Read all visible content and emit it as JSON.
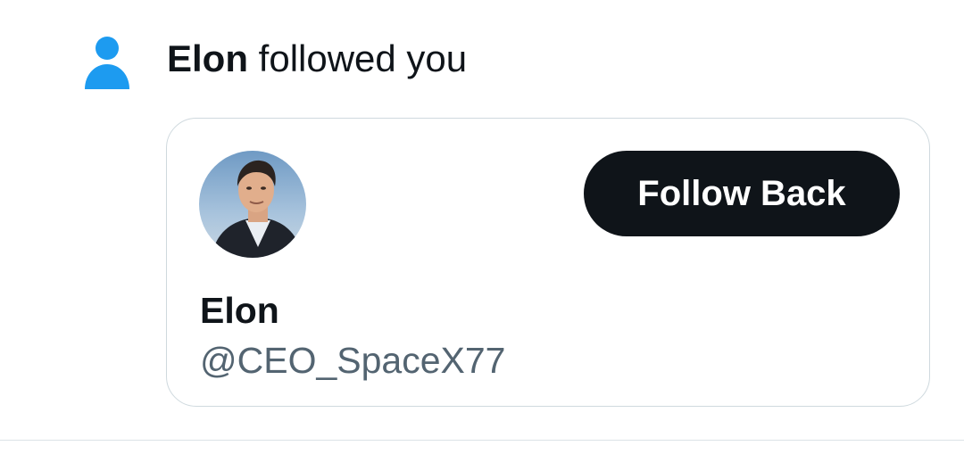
{
  "notification": {
    "type_icon": "person-icon",
    "actor_name": "Elon",
    "action_text": " followed you",
    "card": {
      "avatar_icon": "profile-photo",
      "display_name": "Elon",
      "handle": "@CEO_SpaceX77",
      "follow_button_label": "Follow Back"
    }
  },
  "colors": {
    "accent": "#1d9bf0",
    "button_bg": "#0f1419",
    "button_text": "#ffffff",
    "primary_text": "#0f1419",
    "secondary_text": "#536471",
    "border": "#cfd9de"
  }
}
